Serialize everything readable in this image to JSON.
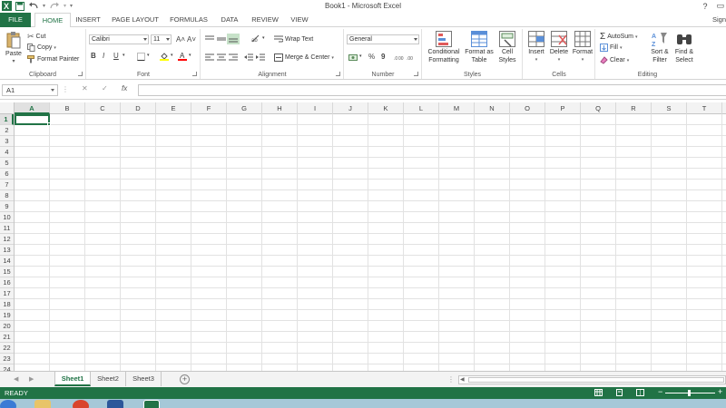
{
  "window": {
    "title": "Book1 - Microsoft Excel",
    "help": "?",
    "restore": "▭",
    "close": "✕"
  },
  "tabs": {
    "file": "FILE",
    "items": [
      "HOME",
      "INSERT",
      "PAGE LAYOUT",
      "FORMULAS",
      "DATA",
      "REVIEW",
      "VIEW"
    ],
    "active": "HOME",
    "sign_in": "Sign"
  },
  "ribbon": {
    "clipboard": {
      "label": "Clipboard",
      "paste": "Paste",
      "cut": "Cut",
      "copy": "Copy",
      "format_painter": "Format Painter"
    },
    "font": {
      "label": "Font",
      "font_name": "Calibri",
      "font_size": "11",
      "bold": "B",
      "italic": "I",
      "underline": "U",
      "grow": "A˄",
      "shrink": "A˅"
    },
    "alignment": {
      "label": "Alignment",
      "wrap_text": "Wrap Text",
      "merge_center": "Merge & Center"
    },
    "number": {
      "label": "Number",
      "format": "General",
      "percent": "%",
      "comma": "9"
    },
    "styles": {
      "label": "Styles",
      "conditional_1": "Conditional",
      "conditional_2": "Formatting",
      "format_as_1": "Format as",
      "format_as_2": "Table",
      "cell_styles_1": "Cell",
      "cell_styles_2": "Styles"
    },
    "cells": {
      "label": "Cells",
      "insert": "Insert",
      "delete": "Delete",
      "format": "Format"
    },
    "editing": {
      "label": "Editing",
      "autosum": "AutoSum",
      "fill": "Fill",
      "clear": "Clear",
      "sort_1": "Sort &",
      "sort_2": "Filter",
      "find_1": "Find &",
      "find_2": "Select"
    }
  },
  "formula_bar": {
    "name_box": "A1",
    "cancel": "✕",
    "enter": "✓",
    "fx": "fx",
    "value": ""
  },
  "grid": {
    "columns": [
      "A",
      "B",
      "C",
      "D",
      "E",
      "F",
      "G",
      "H",
      "I",
      "J",
      "K",
      "L",
      "M",
      "N",
      "O",
      "P",
      "Q",
      "R",
      "S",
      "T"
    ],
    "rows": [
      "1",
      "2",
      "3",
      "4",
      "5",
      "6",
      "7",
      "8",
      "9",
      "10",
      "11",
      "12",
      "13",
      "14",
      "15",
      "16",
      "17",
      "18",
      "19",
      "20",
      "21",
      "22",
      "23",
      "24"
    ],
    "active_cell": "A1"
  },
  "sheets": {
    "tabs": [
      "Sheet1",
      "Sheet2",
      "Sheet3"
    ],
    "active": "Sheet1",
    "add": "+"
  },
  "status": {
    "ready": "READY"
  },
  "colors": {
    "excel_green": "#217346",
    "ribbon_bg": "#ffffff",
    "header_bg": "#f3f3f3",
    "gridline": "#e2e2e2"
  }
}
